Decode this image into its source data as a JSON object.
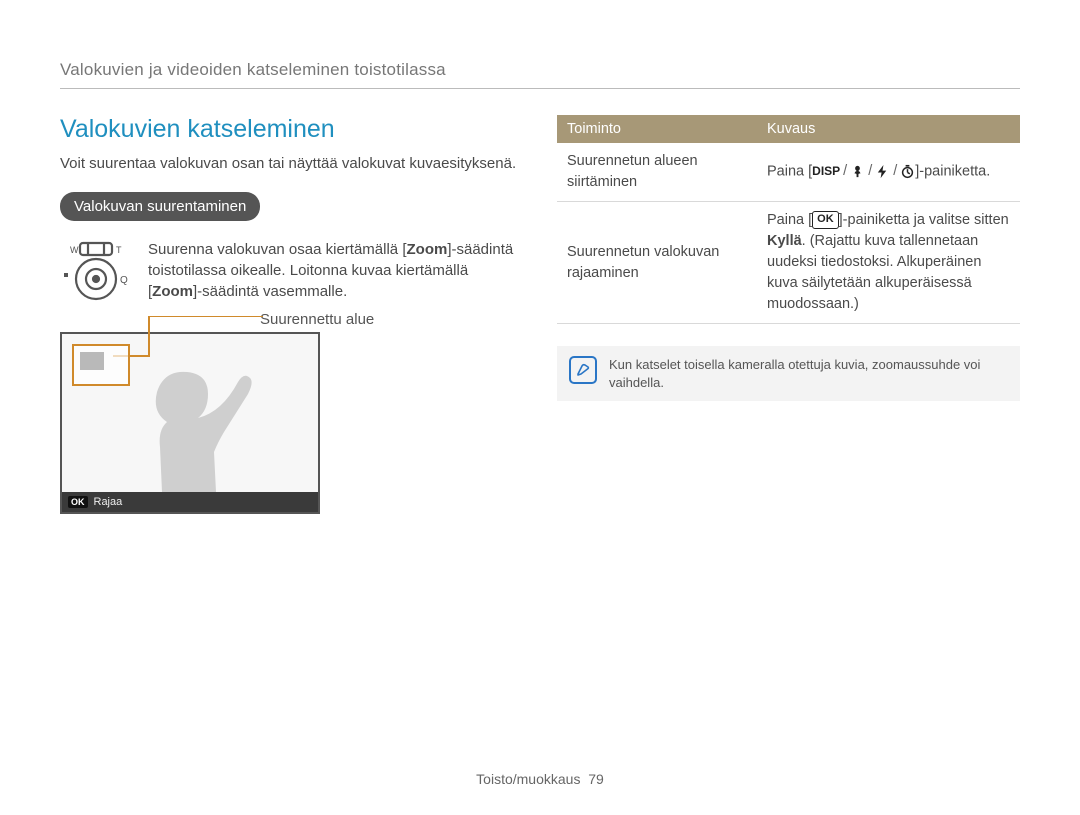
{
  "breadcrumb": "Valokuvien ja videoiden katseleminen toistotilassa",
  "left": {
    "heading": "Valokuvien katseleminen",
    "intro": "Voit suurentaa valokuvan osan tai näyttää valokuvat kuvaesityksenä.",
    "pill": "Valokuvan suurentaminen",
    "zoom_before": "Suurenna valokuvan osaa kiertämällä [",
    "zoom_word1": "Zoom",
    "zoom_mid1": "]-säädintä toistotilassa oikealle. Loitonna kuvaa kiertämällä [",
    "zoom_word2": "Zoom",
    "zoom_after": "]-säädintä vasemmalle.",
    "enlarged_label": "Suurennettu alue",
    "crop_label": "Rajaa",
    "ok_label": "OK",
    "dial": {
      "w": "W",
      "t": "T"
    }
  },
  "right": {
    "header_fn": "Toiminto",
    "header_desc": "Kuvaus",
    "row1_fn": "Suurennetun alueen siirtäminen",
    "row1_desc_pre": "Paina [",
    "row1_desc_post": "]-painiketta.",
    "disp_label": "DISP",
    "row2_fn": "Suurennetun valokuvan rajaaminen",
    "row2_pre": "Paina [",
    "row2_mid": "]-painiketta ja valitse sitten ",
    "row2_word": "Kyllä",
    "row2_post": ". (Rajattu kuva tallennetaan uudeksi tiedostoksi. Alkuperäinen kuva säilytetään alkuperäisessä muodossaan.)",
    "ok_label": "OK",
    "note": "Kun katselet toisella kameralla otettuja kuvia, zoomaussuhde voi vaihdella."
  },
  "footer": {
    "section": "Toisto/muokkaus",
    "page": "79"
  }
}
